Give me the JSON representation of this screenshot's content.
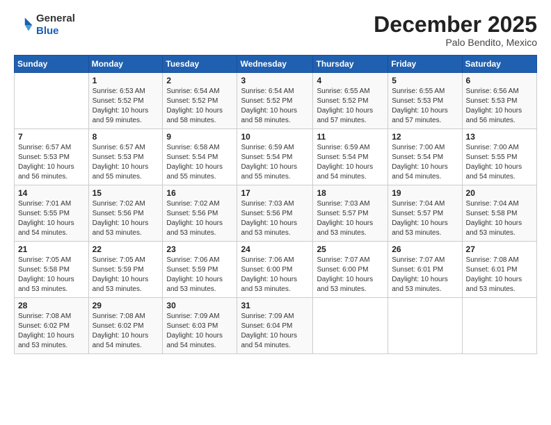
{
  "logo": {
    "general": "General",
    "blue": "Blue"
  },
  "header": {
    "month": "December 2025",
    "location": "Palo Bendito, Mexico"
  },
  "weekdays": [
    "Sunday",
    "Monday",
    "Tuesday",
    "Wednesday",
    "Thursday",
    "Friday",
    "Saturday"
  ],
  "weeks": [
    [
      {
        "day": "",
        "info": ""
      },
      {
        "day": "1",
        "info": "Sunrise: 6:53 AM\nSunset: 5:52 PM\nDaylight: 10 hours\nand 59 minutes."
      },
      {
        "day": "2",
        "info": "Sunrise: 6:54 AM\nSunset: 5:52 PM\nDaylight: 10 hours\nand 58 minutes."
      },
      {
        "day": "3",
        "info": "Sunrise: 6:54 AM\nSunset: 5:52 PM\nDaylight: 10 hours\nand 58 minutes."
      },
      {
        "day": "4",
        "info": "Sunrise: 6:55 AM\nSunset: 5:52 PM\nDaylight: 10 hours\nand 57 minutes."
      },
      {
        "day": "5",
        "info": "Sunrise: 6:55 AM\nSunset: 5:53 PM\nDaylight: 10 hours\nand 57 minutes."
      },
      {
        "day": "6",
        "info": "Sunrise: 6:56 AM\nSunset: 5:53 PM\nDaylight: 10 hours\nand 56 minutes."
      }
    ],
    [
      {
        "day": "7",
        "info": "Sunrise: 6:57 AM\nSunset: 5:53 PM\nDaylight: 10 hours\nand 56 minutes."
      },
      {
        "day": "8",
        "info": "Sunrise: 6:57 AM\nSunset: 5:53 PM\nDaylight: 10 hours\nand 55 minutes."
      },
      {
        "day": "9",
        "info": "Sunrise: 6:58 AM\nSunset: 5:54 PM\nDaylight: 10 hours\nand 55 minutes."
      },
      {
        "day": "10",
        "info": "Sunrise: 6:59 AM\nSunset: 5:54 PM\nDaylight: 10 hours\nand 55 minutes."
      },
      {
        "day": "11",
        "info": "Sunrise: 6:59 AM\nSunset: 5:54 PM\nDaylight: 10 hours\nand 54 minutes."
      },
      {
        "day": "12",
        "info": "Sunrise: 7:00 AM\nSunset: 5:54 PM\nDaylight: 10 hours\nand 54 minutes."
      },
      {
        "day": "13",
        "info": "Sunrise: 7:00 AM\nSunset: 5:55 PM\nDaylight: 10 hours\nand 54 minutes."
      }
    ],
    [
      {
        "day": "14",
        "info": "Sunrise: 7:01 AM\nSunset: 5:55 PM\nDaylight: 10 hours\nand 54 minutes."
      },
      {
        "day": "15",
        "info": "Sunrise: 7:02 AM\nSunset: 5:56 PM\nDaylight: 10 hours\nand 53 minutes."
      },
      {
        "day": "16",
        "info": "Sunrise: 7:02 AM\nSunset: 5:56 PM\nDaylight: 10 hours\nand 53 minutes."
      },
      {
        "day": "17",
        "info": "Sunrise: 7:03 AM\nSunset: 5:56 PM\nDaylight: 10 hours\nand 53 minutes."
      },
      {
        "day": "18",
        "info": "Sunrise: 7:03 AM\nSunset: 5:57 PM\nDaylight: 10 hours\nand 53 minutes."
      },
      {
        "day": "19",
        "info": "Sunrise: 7:04 AM\nSunset: 5:57 PM\nDaylight: 10 hours\nand 53 minutes."
      },
      {
        "day": "20",
        "info": "Sunrise: 7:04 AM\nSunset: 5:58 PM\nDaylight: 10 hours\nand 53 minutes."
      }
    ],
    [
      {
        "day": "21",
        "info": "Sunrise: 7:05 AM\nSunset: 5:58 PM\nDaylight: 10 hours\nand 53 minutes."
      },
      {
        "day": "22",
        "info": "Sunrise: 7:05 AM\nSunset: 5:59 PM\nDaylight: 10 hours\nand 53 minutes."
      },
      {
        "day": "23",
        "info": "Sunrise: 7:06 AM\nSunset: 5:59 PM\nDaylight: 10 hours\nand 53 minutes."
      },
      {
        "day": "24",
        "info": "Sunrise: 7:06 AM\nSunset: 6:00 PM\nDaylight: 10 hours\nand 53 minutes."
      },
      {
        "day": "25",
        "info": "Sunrise: 7:07 AM\nSunset: 6:00 PM\nDaylight: 10 hours\nand 53 minutes."
      },
      {
        "day": "26",
        "info": "Sunrise: 7:07 AM\nSunset: 6:01 PM\nDaylight: 10 hours\nand 53 minutes."
      },
      {
        "day": "27",
        "info": "Sunrise: 7:08 AM\nSunset: 6:01 PM\nDaylight: 10 hours\nand 53 minutes."
      }
    ],
    [
      {
        "day": "28",
        "info": "Sunrise: 7:08 AM\nSunset: 6:02 PM\nDaylight: 10 hours\nand 53 minutes."
      },
      {
        "day": "29",
        "info": "Sunrise: 7:08 AM\nSunset: 6:02 PM\nDaylight: 10 hours\nand 54 minutes."
      },
      {
        "day": "30",
        "info": "Sunrise: 7:09 AM\nSunset: 6:03 PM\nDaylight: 10 hours\nand 54 minutes."
      },
      {
        "day": "31",
        "info": "Sunrise: 7:09 AM\nSunset: 6:04 PM\nDaylight: 10 hours\nand 54 minutes."
      },
      {
        "day": "",
        "info": ""
      },
      {
        "day": "",
        "info": ""
      },
      {
        "day": "",
        "info": ""
      }
    ]
  ]
}
